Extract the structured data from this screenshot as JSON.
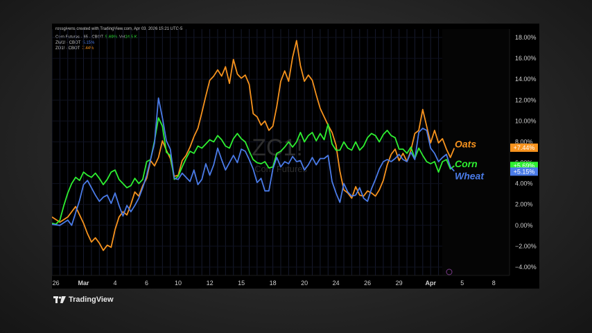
{
  "header": {
    "caption": "rossgivens created with TradingView.com, Apr 03, 2026 15:21 UTC-5",
    "line1": {
      "name": "Corn Futures · 65 · CBOT",
      "change": "5.69%",
      "vol_label": "Vol",
      "vol": "24.5 K"
    },
    "line2": {
      "name": "ZW1! · CBOT",
      "change": "5.15%"
    },
    "line3": {
      "name": "ZO1! · CBOT",
      "change": "7.44%"
    }
  },
  "watermark": {
    "symbol": "ZC1!",
    "subtitle": "Corn Futures"
  },
  "brand": "TradingView",
  "colors": {
    "oats": "#f7931e",
    "corn": "#2ef031",
    "wheat": "#4a7be8",
    "background": "#000000",
    "grid": "#161a2e"
  },
  "chart_data": {
    "type": "line",
    "y_unit": "%",
    "ylim": [
      -4.8,
      18.8
    ],
    "y_ticks": [
      "18.00%",
      "16.00%",
      "14.00%",
      "12.00%",
      "10.00%",
      "8.00%",
      "6.00%",
      "4.00%",
      "2.00%",
      "0.00%",
      "−2.00%",
      "−4.00%"
    ],
    "y_tick_values": [
      18,
      16,
      14,
      12,
      10,
      8,
      6,
      4,
      2,
      0,
      -2,
      -4
    ],
    "x_ticks": [
      "26",
      "Mar",
      "4",
      "6",
      "10",
      "12",
      "15",
      "18",
      "20",
      "24",
      "26",
      "29",
      "Apr",
      "5",
      "8"
    ],
    "x_tick_index": [
      1,
      8,
      16,
      24,
      32,
      40,
      48,
      56,
      64,
      72,
      80,
      88,
      96,
      104,
      112
    ],
    "x_index_range": [
      0,
      116
    ],
    "grid": true,
    "series": [
      {
        "name": "Oats",
        "color": "#f7931e",
        "last_label": "+7.44%",
        "last_value": 7.44,
        "points": [
          [
            0,
            0.8
          ],
          [
            2,
            0.3
          ],
          [
            4,
            0.8
          ],
          [
            6,
            1.8
          ],
          [
            7,
            1.0
          ],
          [
            8,
            0.2
          ],
          [
            9,
            -0.8
          ],
          [
            10,
            -1.6
          ],
          [
            11,
            -1.2
          ],
          [
            12,
            -1.7
          ],
          [
            13,
            -2.4
          ],
          [
            14,
            -1.9
          ],
          [
            15,
            -2.1
          ],
          [
            16,
            -0.4
          ],
          [
            17,
            0.8
          ],
          [
            18,
            1.3
          ],
          [
            19,
            1.0
          ],
          [
            20,
            2.0
          ],
          [
            21,
            3.2
          ],
          [
            22,
            2.8
          ],
          [
            23,
            3.8
          ],
          [
            24,
            4.5
          ],
          [
            25,
            6.2
          ],
          [
            26,
            5.7
          ],
          [
            27,
            6.5
          ],
          [
            28,
            8.1
          ],
          [
            29,
            7.2
          ],
          [
            30,
            6.4
          ],
          [
            31,
            4.7
          ],
          [
            32,
            4.8
          ],
          [
            33,
            6.2
          ],
          [
            34,
            6.7
          ],
          [
            35,
            7.5
          ],
          [
            36,
            8.5
          ],
          [
            37,
            9.3
          ],
          [
            38,
            10.8
          ],
          [
            39,
            12.4
          ],
          [
            40,
            13.9
          ],
          [
            41,
            14.3
          ],
          [
            42,
            14.9
          ],
          [
            43,
            14.3
          ],
          [
            44,
            15.2
          ],
          [
            45,
            13.6
          ],
          [
            46,
            15.9
          ],
          [
            47,
            14.5
          ],
          [
            48,
            14.1
          ],
          [
            49,
            14.4
          ],
          [
            50,
            13.5
          ],
          [
            51,
            10.7
          ],
          [
            52,
            10.4
          ],
          [
            53,
            9.6
          ],
          [
            54,
            10.0
          ],
          [
            55,
            9.1
          ],
          [
            56,
            9.5
          ],
          [
            57,
            11.4
          ],
          [
            58,
            13.8
          ],
          [
            59,
            14.8
          ],
          [
            60,
            13.8
          ],
          [
            61,
            16.1
          ],
          [
            62,
            17.7
          ],
          [
            63,
            15.3
          ],
          [
            64,
            13.8
          ],
          [
            65,
            14.4
          ],
          [
            66,
            13.9
          ],
          [
            67,
            12.5
          ],
          [
            68,
            11.2
          ],
          [
            69,
            10.4
          ],
          [
            70,
            9.6
          ],
          [
            71,
            8.9
          ],
          [
            72,
            7.7
          ],
          [
            73,
            5.2
          ],
          [
            74,
            3.4
          ],
          [
            75,
            3.1
          ],
          [
            76,
            2.6
          ],
          [
            77,
            3.7
          ],
          [
            78,
            2.9
          ],
          [
            79,
            2.8
          ],
          [
            80,
            3.3
          ],
          [
            81,
            3.1
          ],
          [
            82,
            2.8
          ],
          [
            83,
            3.4
          ],
          [
            84,
            4.3
          ],
          [
            85,
            5.8
          ],
          [
            86,
            6.8
          ],
          [
            87,
            7.3
          ],
          [
            88,
            6.2
          ],
          [
            89,
            6.9
          ],
          [
            90,
            6.1
          ],
          [
            91,
            7.2
          ],
          [
            92,
            8.8
          ],
          [
            93,
            9.1
          ],
          [
            94,
            11.1
          ],
          [
            95,
            9.5
          ],
          [
            96,
            7.9
          ],
          [
            97,
            9.1
          ],
          [
            98,
            7.9
          ],
          [
            99,
            8.3
          ],
          [
            100,
            7.3
          ],
          [
            101,
            6.5
          ],
          [
            102,
            7.4
          ]
        ]
      },
      {
        "name": "Corn",
        "color": "#2ef031",
        "last_label": "+5.69%",
        "last_value": 5.69,
        "points": [
          [
            0,
            0.2
          ],
          [
            1,
            0.1
          ],
          [
            2,
            0.5
          ],
          [
            3,
            1.9
          ],
          [
            4,
            3.1
          ],
          [
            5,
            4.0
          ],
          [
            6,
            4.6
          ],
          [
            7,
            4.3
          ],
          [
            8,
            5.1
          ],
          [
            9,
            4.8
          ],
          [
            10,
            4.6
          ],
          [
            11,
            5.0
          ],
          [
            12,
            4.5
          ],
          [
            13,
            3.9
          ],
          [
            14,
            4.4
          ],
          [
            15,
            5.1
          ],
          [
            16,
            5.3
          ],
          [
            17,
            4.4
          ],
          [
            18,
            4.0
          ],
          [
            19,
            3.6
          ],
          [
            20,
            3.8
          ],
          [
            21,
            4.5
          ],
          [
            22,
            4.0
          ],
          [
            23,
            4.4
          ],
          [
            24,
            6.1
          ],
          [
            25,
            6.3
          ],
          [
            26,
            8.1
          ],
          [
            27,
            10.3
          ],
          [
            28,
            9.5
          ],
          [
            29,
            7.0
          ],
          [
            30,
            6.7
          ],
          [
            31,
            4.4
          ],
          [
            32,
            4.7
          ],
          [
            33,
            5.6
          ],
          [
            34,
            6.4
          ],
          [
            35,
            7.1
          ],
          [
            36,
            6.9
          ],
          [
            37,
            7.6
          ],
          [
            38,
            7.4
          ],
          [
            39,
            7.8
          ],
          [
            40,
            8.2
          ],
          [
            41,
            8.0
          ],
          [
            42,
            8.6
          ],
          [
            43,
            8.2
          ],
          [
            44,
            7.6
          ],
          [
            45,
            7.4
          ],
          [
            46,
            8.3
          ],
          [
            47,
            8.8
          ],
          [
            48,
            8.3
          ],
          [
            49,
            8.0
          ],
          [
            50,
            7.1
          ],
          [
            51,
            6.3
          ],
          [
            52,
            6.0
          ],
          [
            53,
            5.9
          ],
          [
            54,
            6.1
          ],
          [
            55,
            5.5
          ],
          [
            56,
            5.6
          ],
          [
            57,
            6.9
          ],
          [
            58,
            7.1
          ],
          [
            59,
            7.5
          ],
          [
            60,
            8.0
          ],
          [
            61,
            7.5
          ],
          [
            62,
            8.0
          ],
          [
            63,
            8.9
          ],
          [
            64,
            8.0
          ],
          [
            65,
            8.6
          ],
          [
            66,
            8.9
          ],
          [
            67,
            8.1
          ],
          [
            68,
            8.8
          ],
          [
            69,
            8.2
          ],
          [
            70,
            9.7
          ],
          [
            71,
            7.8
          ],
          [
            72,
            7.2
          ],
          [
            73,
            7.2
          ],
          [
            74,
            8.0
          ],
          [
            75,
            7.4
          ],
          [
            76,
            7.2
          ],
          [
            77,
            8.0
          ],
          [
            78,
            7.2
          ],
          [
            79,
            7.6
          ],
          [
            80,
            8.4
          ],
          [
            81,
            8.8
          ],
          [
            82,
            8.6
          ],
          [
            83,
            8.0
          ],
          [
            84,
            8.7
          ],
          [
            85,
            9.1
          ],
          [
            86,
            8.6
          ],
          [
            87,
            8.4
          ],
          [
            88,
            7.3
          ],
          [
            89,
            7.3
          ],
          [
            90,
            6.9
          ],
          [
            91,
            7.5
          ],
          [
            92,
            6.4
          ],
          [
            93,
            7.4
          ],
          [
            94,
            6.7
          ],
          [
            95,
            6.1
          ],
          [
            96,
            5.9
          ],
          [
            97,
            6.1
          ],
          [
            98,
            5.1
          ],
          [
            99,
            6.1
          ],
          [
            100,
            6.3
          ],
          [
            101,
            5.4
          ],
          [
            102,
            5.7
          ]
        ]
      },
      {
        "name": "Wheat",
        "color": "#4a7be8",
        "last_label": "+5.15%",
        "last_value": 5.15,
        "points": [
          [
            0,
            0.1
          ],
          [
            2,
            0.0
          ],
          [
            4,
            0.5
          ],
          [
            5,
            0.0
          ],
          [
            6,
            1.2
          ],
          [
            7,
            2.4
          ],
          [
            8,
            3.9
          ],
          [
            9,
            4.3
          ],
          [
            10,
            3.6
          ],
          [
            11,
            2.9
          ],
          [
            12,
            2.3
          ],
          [
            13,
            2.7
          ],
          [
            14,
            2.9
          ],
          [
            15,
            2.1
          ],
          [
            16,
            3.1
          ],
          [
            17,
            1.9
          ],
          [
            18,
            0.9
          ],
          [
            19,
            1.9
          ],
          [
            20,
            1.3
          ],
          [
            21,
            1.9
          ],
          [
            22,
            2.6
          ],
          [
            23,
            3.6
          ],
          [
            24,
            4.8
          ],
          [
            25,
            6.3
          ],
          [
            26,
            7.9
          ],
          [
            27,
            12.2
          ],
          [
            28,
            10.3
          ],
          [
            29,
            8.1
          ],
          [
            30,
            7.3
          ],
          [
            31,
            4.5
          ],
          [
            32,
            4.4
          ],
          [
            33,
            5.0
          ],
          [
            34,
            4.6
          ],
          [
            35,
            4.2
          ],
          [
            36,
            5.3
          ],
          [
            37,
            3.9
          ],
          [
            38,
            4.4
          ],
          [
            39,
            5.9
          ],
          [
            40,
            4.8
          ],
          [
            41,
            5.8
          ],
          [
            42,
            7.4
          ],
          [
            43,
            6.3
          ],
          [
            44,
            5.3
          ],
          [
            45,
            6.0
          ],
          [
            46,
            6.7
          ],
          [
            47,
            6.0
          ],
          [
            48,
            7.3
          ],
          [
            49,
            7.1
          ],
          [
            50,
            6.3
          ],
          [
            51,
            5.4
          ],
          [
            52,
            4.1
          ],
          [
            53,
            4.5
          ],
          [
            54,
            3.3
          ],
          [
            55,
            3.3
          ],
          [
            56,
            5.4
          ],
          [
            57,
            6.5
          ],
          [
            58,
            5.6
          ],
          [
            59,
            6.1
          ],
          [
            60,
            5.9
          ],
          [
            61,
            6.6
          ],
          [
            62,
            6.1
          ],
          [
            63,
            6.2
          ],
          [
            64,
            5.3
          ],
          [
            65,
            5.8
          ],
          [
            66,
            6.5
          ],
          [
            67,
            5.8
          ],
          [
            68,
            6.4
          ],
          [
            69,
            6.4
          ],
          [
            70,
            6.7
          ],
          [
            71,
            4.2
          ],
          [
            72,
            3.1
          ],
          [
            73,
            2.2
          ],
          [
            74,
            4.0
          ],
          [
            75,
            3.2
          ],
          [
            76,
            2.8
          ],
          [
            77,
            2.9
          ],
          [
            78,
            3.6
          ],
          [
            79,
            2.6
          ],
          [
            80,
            2.3
          ],
          [
            81,
            3.5
          ],
          [
            82,
            4.4
          ],
          [
            83,
            5.4
          ],
          [
            84,
            6.1
          ],
          [
            85,
            6.3
          ],
          [
            86,
            6.1
          ],
          [
            87,
            6.4
          ],
          [
            88,
            6.8
          ],
          [
            89,
            6.3
          ],
          [
            90,
            6.1
          ],
          [
            91,
            7.0
          ],
          [
            92,
            6.3
          ],
          [
            93,
            8.9
          ],
          [
            94,
            9.3
          ],
          [
            95,
            9.1
          ],
          [
            96,
            7.4
          ],
          [
            97,
            6.9
          ],
          [
            98,
            6.1
          ],
          [
            99,
            6.5
          ],
          [
            100,
            6.8
          ],
          [
            101,
            5.6
          ],
          [
            102,
            5.2
          ]
        ]
      }
    ]
  }
}
